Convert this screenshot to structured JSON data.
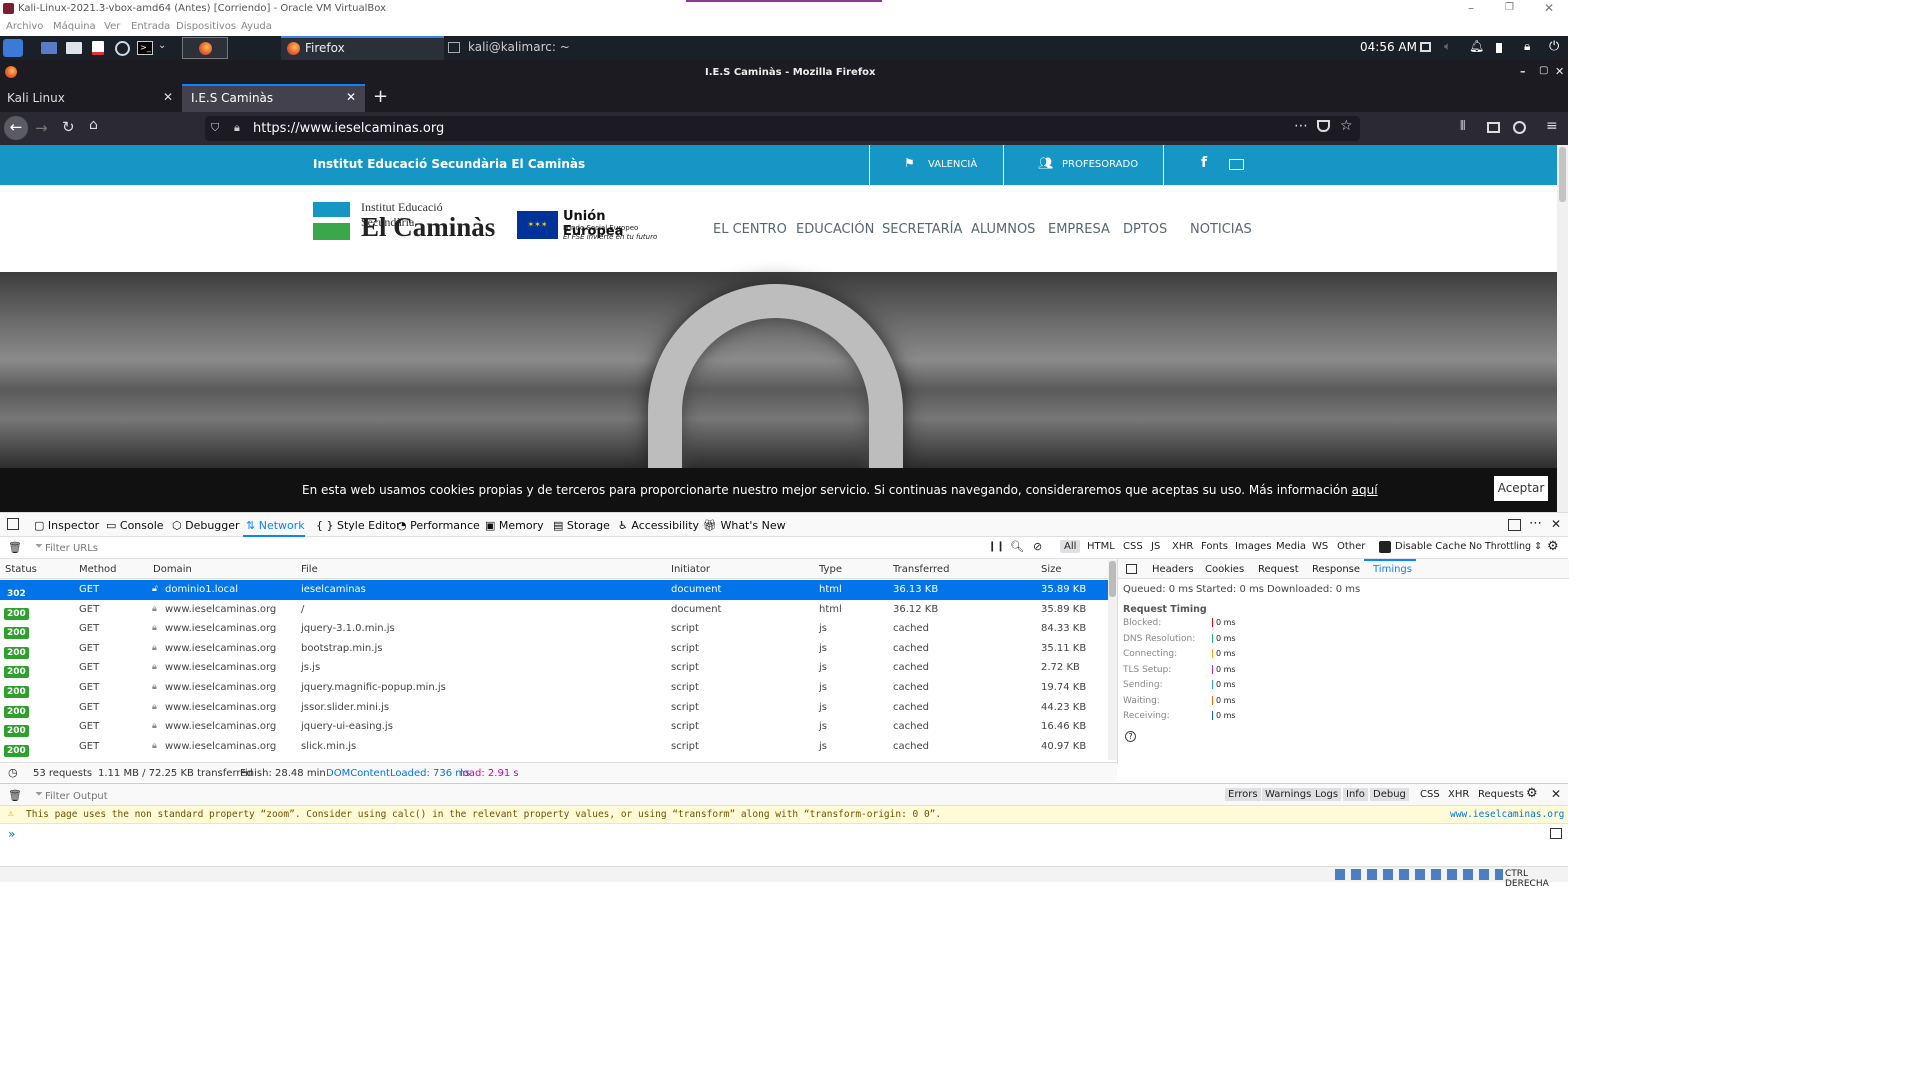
{
  "vbox": {
    "title": "Kali-Linux-2021.3-vbox-amd64 (Antes) [Corriendo] - Oracle VM VirtualBox",
    "menu": [
      "Archivo",
      "Máquina",
      "Ver",
      "Entrada",
      "Dispositivos",
      "Ayuda"
    ],
    "host_key": "CTRL DERECHA"
  },
  "panel": {
    "tasks": [
      {
        "label": "Firefox",
        "icon": "firefox-icon"
      },
      {
        "label": "kali@kalimarc: ~",
        "icon": "terminal-icon"
      }
    ],
    "clock": "04:56 AM"
  },
  "firefox": {
    "window_title": "I.E.S Caminàs - Mozilla Firefox",
    "tabs": [
      {
        "label": "Kali Linux",
        "active": false
      },
      {
        "label": "I.E.S Caminàs",
        "active": true
      }
    ],
    "url": "https://www.ieselcaminas.org"
  },
  "website": {
    "topbar_title": "Institut Educació Secundària El Caminàs",
    "topbar_links": [
      "VALENCIÀ",
      "PROFESORADO"
    ],
    "logo_small": "Institut Educació Secundària",
    "logo_big": "El Caminàs",
    "eu_title": "Unión Europea",
    "eu_sub1": "Fondo Social Europeo",
    "eu_sub2": "El FSE invierte en tu futuro",
    "nav": [
      "EL CENTRO",
      "EDUCACIÓN",
      "SECRETARÍA",
      "ALUMNOS",
      "EMPRESA",
      "DPTOS",
      "NOTICIAS"
    ],
    "cookie_text": "En esta web usamos cookies propias y de terceros para proporcionarte nuestro mejor servicio. Si continuas navegando, consideraremos que aceptas su uso. Más información",
    "cookie_link": "aquí",
    "cookie_button": "Aceptar"
  },
  "devtools": {
    "tabs": [
      "Inspector",
      "Console",
      "Debugger",
      "Network",
      "Style Editor",
      "Performance",
      "Memory",
      "Storage",
      "Accessibility",
      "What's New"
    ],
    "active_tab": "Network",
    "filter_placeholder": "Filter URLs",
    "type_filters": [
      "All",
      "HTML",
      "CSS",
      "JS",
      "XHR",
      "Fonts",
      "Images",
      "Media",
      "WS",
      "Other"
    ],
    "disable_cache": "Disable Cache",
    "throttling": "No Throttling ⇕",
    "columns": [
      "Status",
      "Method",
      "Domain",
      "File",
      "Initiator",
      "Type",
      "Transferred",
      "Size"
    ],
    "requests": [
      {
        "status": "302",
        "method": "GET",
        "domain": "dominio1.local",
        "file": "ieselcaminas",
        "initiator": "document",
        "type": "html",
        "transferred": "36.13 KB",
        "size": "35.89 KB",
        "selected": true
      },
      {
        "status": "200",
        "method": "GET",
        "domain": "www.ieselcaminas.org",
        "file": "/",
        "initiator": "document",
        "type": "html",
        "transferred": "36.12 KB",
        "size": "35.89 KB"
      },
      {
        "status": "200",
        "method": "GET",
        "domain": "www.ieselcaminas.org",
        "file": "jquery-3.1.0.min.js",
        "initiator": "script",
        "type": "js",
        "transferred": "cached",
        "size": "84.33 KB"
      },
      {
        "status": "200",
        "method": "GET",
        "domain": "www.ieselcaminas.org",
        "file": "bootstrap.min.js",
        "initiator": "script",
        "type": "js",
        "transferred": "cached",
        "size": "35.11 KB"
      },
      {
        "status": "200",
        "method": "GET",
        "domain": "www.ieselcaminas.org",
        "file": "js.js",
        "initiator": "script",
        "type": "js",
        "transferred": "cached",
        "size": "2.72 KB"
      },
      {
        "status": "200",
        "method": "GET",
        "domain": "www.ieselcaminas.org",
        "file": "jquery.magnific-popup.min.js",
        "initiator": "script",
        "type": "js",
        "transferred": "cached",
        "size": "19.74 KB"
      },
      {
        "status": "200",
        "method": "GET",
        "domain": "www.ieselcaminas.org",
        "file": "jssor.slider.mini.js",
        "initiator": "script",
        "type": "js",
        "transferred": "cached",
        "size": "44.23 KB"
      },
      {
        "status": "200",
        "method": "GET",
        "domain": "www.ieselcaminas.org",
        "file": "jquery-ui-easing.js",
        "initiator": "script",
        "type": "js",
        "transferred": "cached",
        "size": "16.46 KB"
      },
      {
        "status": "200",
        "method": "GET",
        "domain": "www.ieselcaminas.org",
        "file": "slick.min.js",
        "initiator": "script",
        "type": "js",
        "transferred": "cached",
        "size": "40.97 KB"
      }
    ],
    "summary": {
      "requests": "53 requests",
      "transferred": "1.11 MB / 72.25 KB transferred",
      "finish": "Finish: 28.48 min",
      "dcl": "DOMContentLoaded: 736 ms",
      "load": "load: 2.91 s"
    },
    "side_tabs": [
      "Headers",
      "Cookies",
      "Request",
      "Response",
      "Timings"
    ],
    "side_active": "Timings",
    "queued": "Queued: 0 ms",
    "started": "Started: 0 ms",
    "downloaded": "Downloaded: 0 ms",
    "timing_title": "Request Timing",
    "timings": [
      {
        "label": "Blocked:",
        "value": "0 ms"
      },
      {
        "label": "DNS Resolution:",
        "value": "0 ms"
      },
      {
        "label": "Connecting:",
        "value": "0 ms"
      },
      {
        "label": "TLS Setup:",
        "value": "0 ms"
      },
      {
        "label": "Sending:",
        "value": "0 ms"
      },
      {
        "label": "Waiting:",
        "value": "0 ms"
      },
      {
        "label": "Receiving:",
        "value": "0 ms"
      }
    ],
    "console_filter_placeholder": "Filter Output",
    "console_levels": [
      "Errors",
      "Warnings",
      "Logs",
      "Info",
      "Debug"
    ],
    "console_extra": [
      "CSS",
      "XHR",
      "Requests"
    ],
    "warning": "This page uses the non standard property “zoom”. Consider using calc() in the relevant property values, or using “transform” along with “transform-origin: 0 0”.",
    "warning_source": "www.ieselcaminas.org"
  }
}
